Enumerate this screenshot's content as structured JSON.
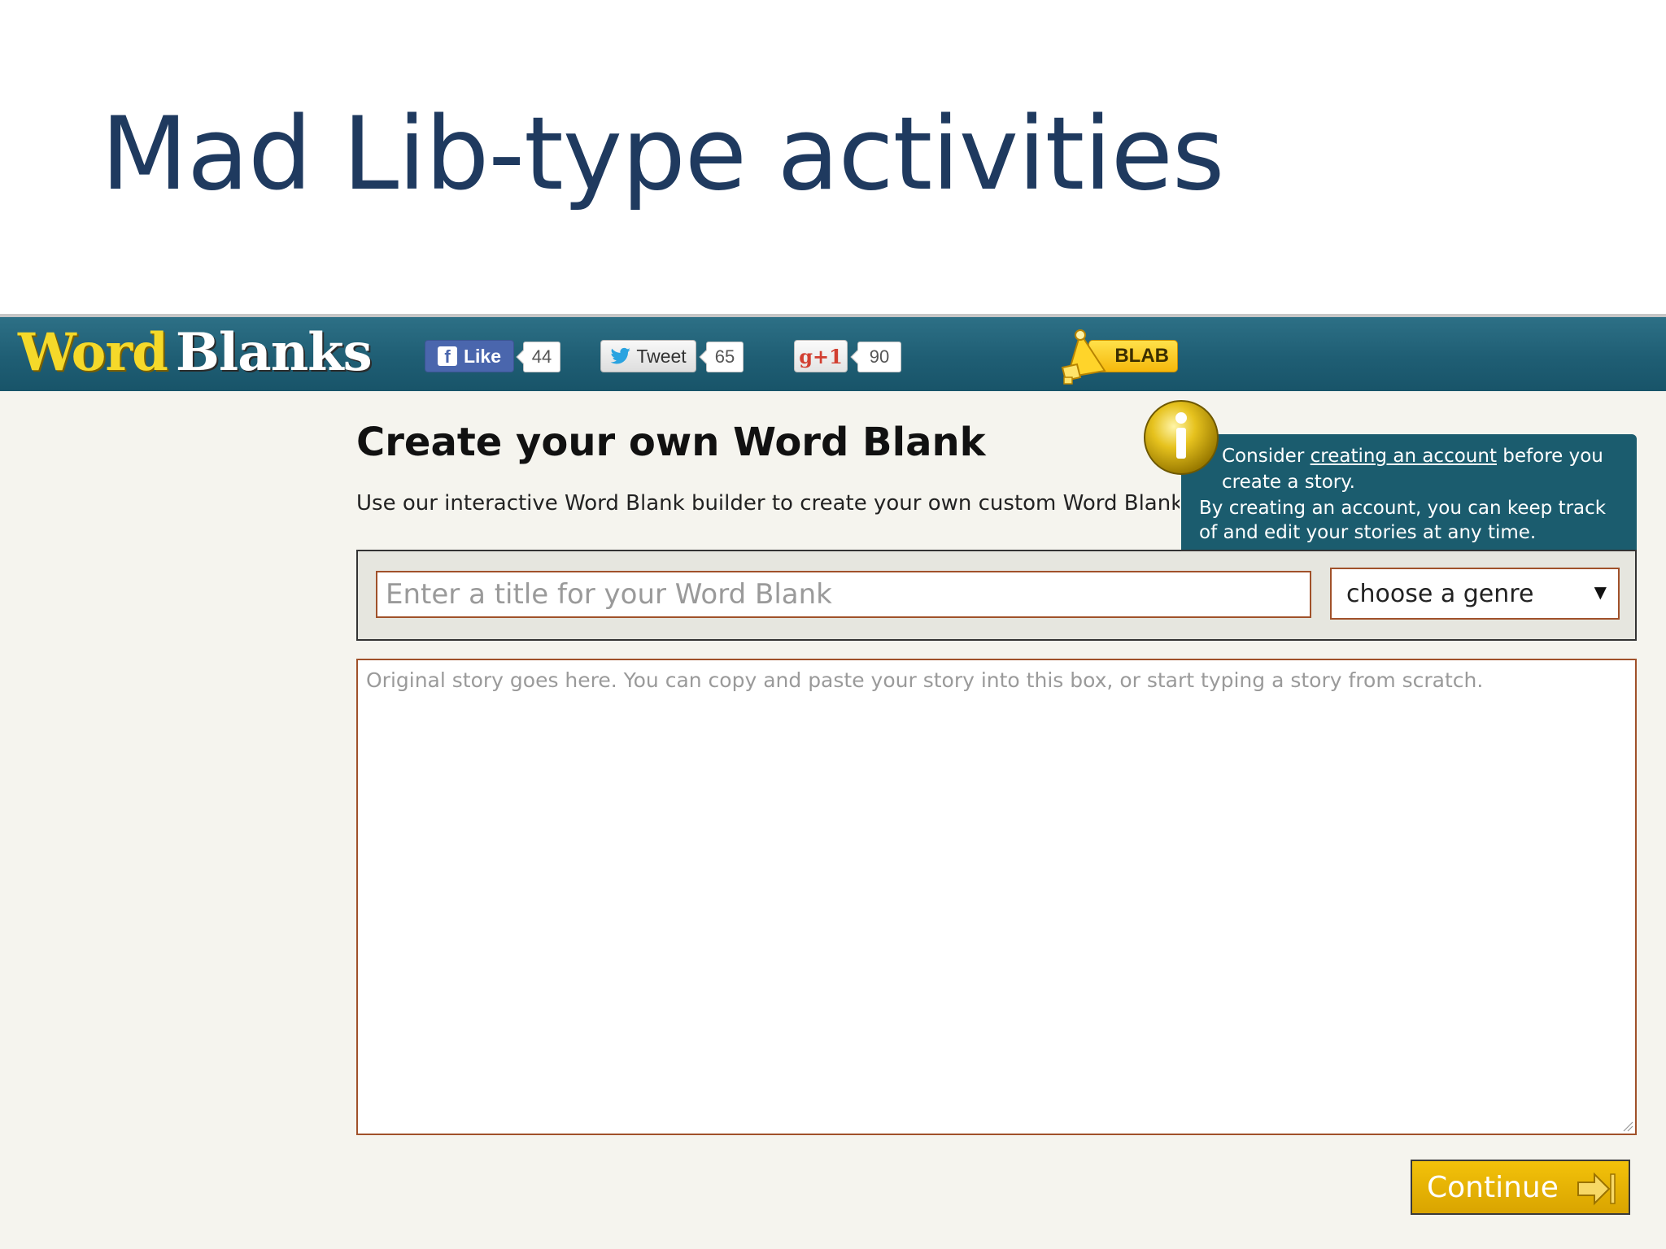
{
  "slide": {
    "title": "Mad Lib-type activities"
  },
  "site": {
    "logo_word1": "Word",
    "logo_word2": "Blanks"
  },
  "social": {
    "facebook_label": "Like",
    "facebook_count": "44",
    "twitter_label": "Tweet",
    "twitter_count": "65",
    "gplus_label": "g+1",
    "gplus_count": "90"
  },
  "blab": {
    "label": "BLAB"
  },
  "main": {
    "heading": "Create your own Word Blank",
    "subtext": "Use our interactive Word Blank builder to create your own custom Word Blank"
  },
  "tooltip": {
    "line1_prefix": "Consider ",
    "line1_link": "creating an account",
    "line1_suffix": " before you",
    "line2": "create a story.",
    "line3": "By creating an account, you can keep track",
    "line4": "of and edit your stories at any time."
  },
  "form": {
    "title_placeholder": "Enter a title for your Word Blank",
    "genre_selected": "choose a genre",
    "story_placeholder": "Original story goes here. You can copy and paste your story into this box, or start typing a story from scratch."
  },
  "continue": {
    "label": "Continue"
  },
  "colors": {
    "slide_title": "#1f3a5f",
    "nav_bar": "#1f5e74",
    "logo_yellow": "#f5d92a",
    "input_border": "#a0512a",
    "continue_button": "#e6b200",
    "tooltip_bg": "#1b5c6e"
  },
  "icons": {
    "facebook": "facebook-icon",
    "twitter": "twitter-bird-icon",
    "megaphone": "megaphone-icon",
    "info": "info-icon",
    "dropdown": "dropdown-arrow-icon",
    "continue": "arrow-right-bar-icon"
  }
}
